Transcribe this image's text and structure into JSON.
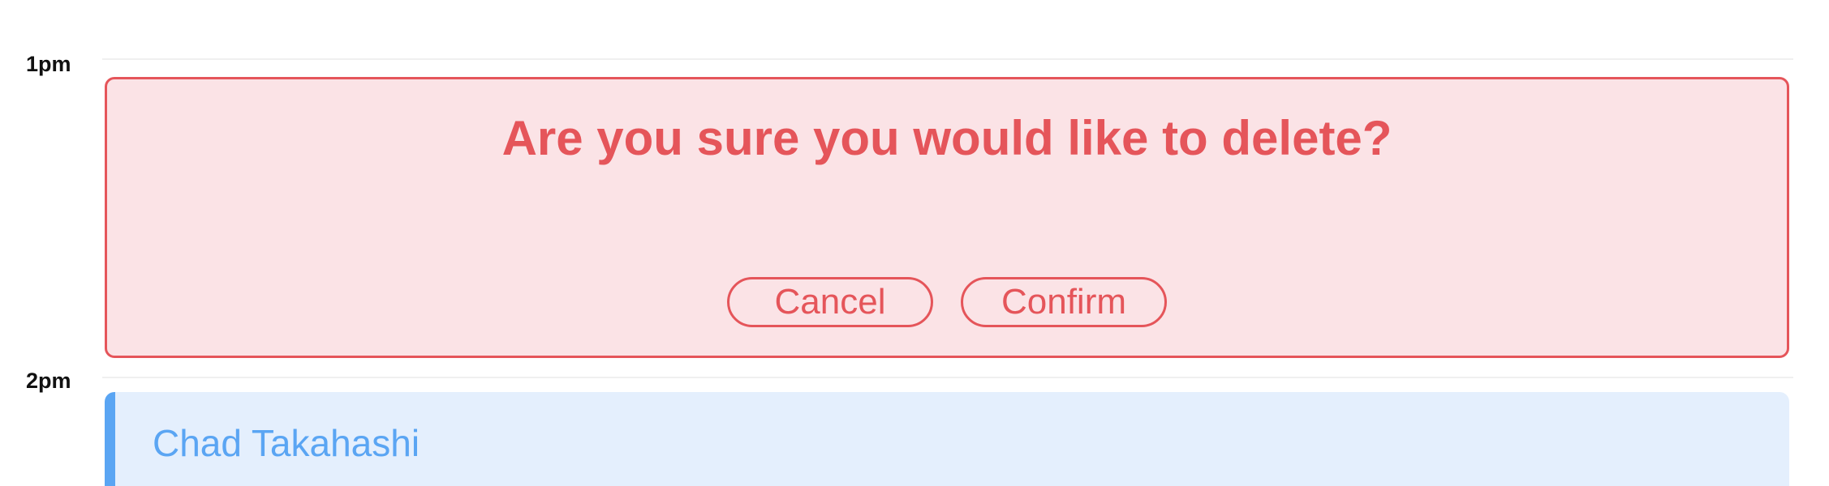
{
  "timeline": {
    "slots": [
      {
        "label": "1pm"
      },
      {
        "label": "2pm"
      }
    ]
  },
  "delete_confirmation": {
    "title": "Are you sure you would like to delete?",
    "cancel_label": "Cancel",
    "confirm_label": "Confirm"
  },
  "event": {
    "name": "Chad Takahashi"
  },
  "colors": {
    "danger": "#e5555a",
    "danger_bg": "#fbe3e6",
    "event_accent": "#5aa5f3",
    "event_bg": "#e4effd"
  }
}
